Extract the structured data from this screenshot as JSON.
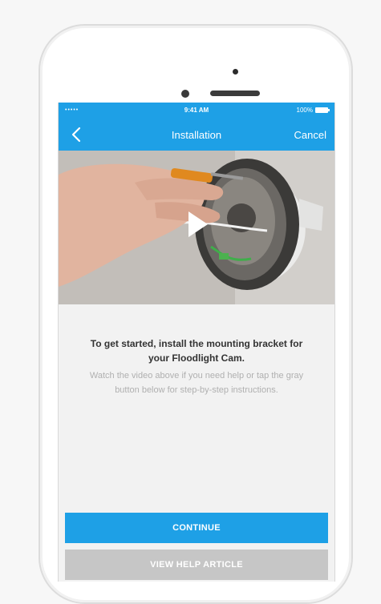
{
  "statusbar": {
    "signal": "•••••",
    "time": "9:41 AM",
    "battery_percent": "100%"
  },
  "navbar": {
    "title": "Installation",
    "cancel_label": "Cancel",
    "back_icon": "chevron-left-icon"
  },
  "video": {
    "play_icon": "play-icon"
  },
  "main": {
    "heading": "To get started, install the mounting bracket for your Floodlight Cam.",
    "subtext": "Watch the video above if you need help or tap the gray button below for step-by-step instructions."
  },
  "buttons": {
    "continue_label": "CONTINUE",
    "help_label": "VIEW HELP ARTICLE"
  },
  "colors": {
    "accent": "#1ea0e6",
    "secondary_button": "#c6c6c6"
  }
}
